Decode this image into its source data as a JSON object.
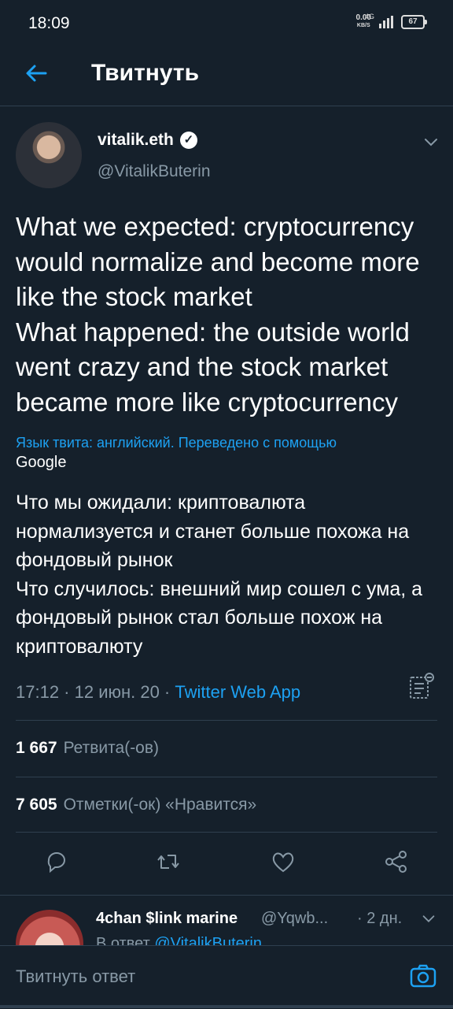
{
  "status_bar": {
    "time": "18:09",
    "net_speed_value": "0.00",
    "net_speed_unit": "KB/S",
    "network": "4G",
    "battery": "67"
  },
  "header": {
    "title": "Твитнуть"
  },
  "tweet": {
    "author_name": "vitalik.eth",
    "author_handle": "@VitalikButerin",
    "text": "What we expected: cryptocurrency would normalize and become more like the stock market\nWhat happened: the outside world went crazy and the stock market became more like cryptocurrency",
    "translated_notice": "Язык твита: английский. Переведено с помощью",
    "translator": "Google",
    "translation": "Что мы ожидали: криптовалюта нормализуется и станет больше похожа на фондовый рынок\n Что случилось: внешний мир сошел с ума, а фондовый рынок стал больше похож на криптовалюту",
    "timestamp": "17:12 · 12 июн. 20 · ",
    "source": "Twitter Web App",
    "retweets_count": "1 667",
    "retweets_label": "Ретвита(-ов)",
    "likes_count": "7 605",
    "likes_label": "Отметки(-ок) «Нравится»"
  },
  "icons": {
    "back": "arrow-left-icon",
    "verified": "verified-badge-icon",
    "more": "chevron-down-icon",
    "analytics": "analytics-icon",
    "reply": "reply-icon",
    "retweet": "retweet-icon",
    "like": "heart-icon",
    "share": "share-icon",
    "camera": "camera-icon"
  },
  "reply": {
    "name": "4chan $link marine",
    "handle": "@Yqwb...",
    "age": "· 2 дн.",
    "reply_to_prefix": "В ответ ",
    "reply_to_handle": "@VitalikButerin"
  },
  "composer": {
    "placeholder": "Твитнуть ответ"
  },
  "colors": {
    "background": "#15202b",
    "accent": "#1da1f2",
    "muted": "#8899a6"
  }
}
